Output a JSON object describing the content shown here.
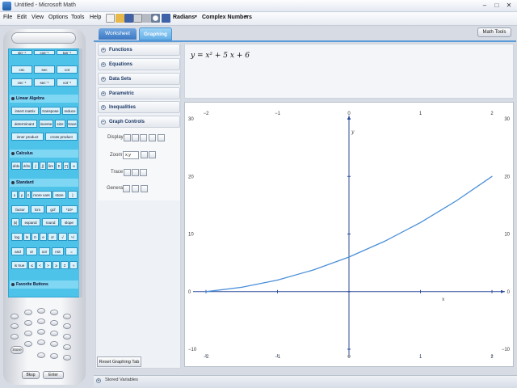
{
  "window": {
    "title": "Untitled - Microsoft Math"
  },
  "menubar": {
    "items": [
      "File",
      "Edit",
      "View",
      "Options",
      "Tools",
      "Help"
    ],
    "angle_mode": "Radians",
    "number_mode": "Complex Numbers"
  },
  "tabs": {
    "worksheet": "Worksheet",
    "graphing": "Graphing",
    "math_tools": "Math Tools"
  },
  "panel": {
    "sections": [
      "Functions",
      "Equations",
      "Data Sets",
      "Parametric",
      "Inequalities",
      "Graph Controls"
    ],
    "graph_controls": {
      "display": "Display",
      "zoom": "Zoom",
      "zoom_value": "x,y",
      "trace": "Trace",
      "general": "General"
    },
    "reset": "Reset Graphing Tab"
  },
  "pad": {
    "trig_row0": [
      "sin⁻¹",
      "cos⁻¹",
      "tan⁻¹"
    ],
    "trig_row1": [
      "csc",
      "sec",
      "cot"
    ],
    "trig_row2": [
      "csc⁻¹",
      "sec⁻¹",
      "cot⁻¹"
    ],
    "linear_algebra": "Linear Algebra",
    "la_row1": [
      "insert matrix",
      "transpose",
      "reduce"
    ],
    "la_row2": [
      "determinant",
      "inverse",
      "size",
      "trace"
    ],
    "la_row3": [
      "inner product",
      "cross product"
    ],
    "calculus": "Calculus",
    "calc_row": [
      "d/dx",
      "∂/∂x",
      "∫",
      "∬",
      "lim",
      "Σ",
      "∏",
      "∞"
    ],
    "standard": "Standard",
    "std_row1": [
      "x",
      "y",
      "z",
      "more vars",
      "store",
      "|"
    ],
    "std_row2": [
      "factor",
      "lcm",
      "gcf",
      "*10ⁿ"
    ],
    "std_row3": [
      "|x|",
      "expand",
      "round",
      "slope"
    ],
    "std_row4": [
      "log",
      "ln",
      "π",
      "e",
      "xʸ",
      "√",
      "ⁿ√"
    ],
    "std_row5": [
      "and",
      "or",
      "xor",
      "not",
      "="
    ],
    "std_row6": [
      "is true",
      "≤",
      "<",
      ">",
      "≥",
      "≠",
      "≈"
    ],
    "favorites": "Favorite Buttons",
    "store_key": "Store",
    "backspace": "Bksp",
    "enter": "Enter"
  },
  "equation": {
    "lhs": "y",
    "rhs": "x² + 5 x + 6"
  },
  "status": "Stored Variables",
  "colors": {
    "curve": "#4a8fd8",
    "axis": "#2c4a9a",
    "accent": "#4dc3ea"
  },
  "chart_data": {
    "type": "line",
    "title": "",
    "xlabel": "x",
    "ylabel": "y",
    "xlim": [
      -2,
      2
    ],
    "ylim": [
      -10,
      30
    ],
    "x_ticks": [
      -2,
      -1,
      0,
      1,
      2
    ],
    "y_ticks": [
      -10,
      0,
      10,
      20,
      30
    ],
    "grid": false,
    "series": [
      {
        "x": [
          -2,
          -1.5,
          -1,
          -0.5,
          0,
          0.5,
          1,
          1.5,
          2
        ],
        "y": [
          0,
          0.75,
          2,
          3.75,
          6,
          8.75,
          12,
          15.75,
          20
        ]
      }
    ]
  }
}
